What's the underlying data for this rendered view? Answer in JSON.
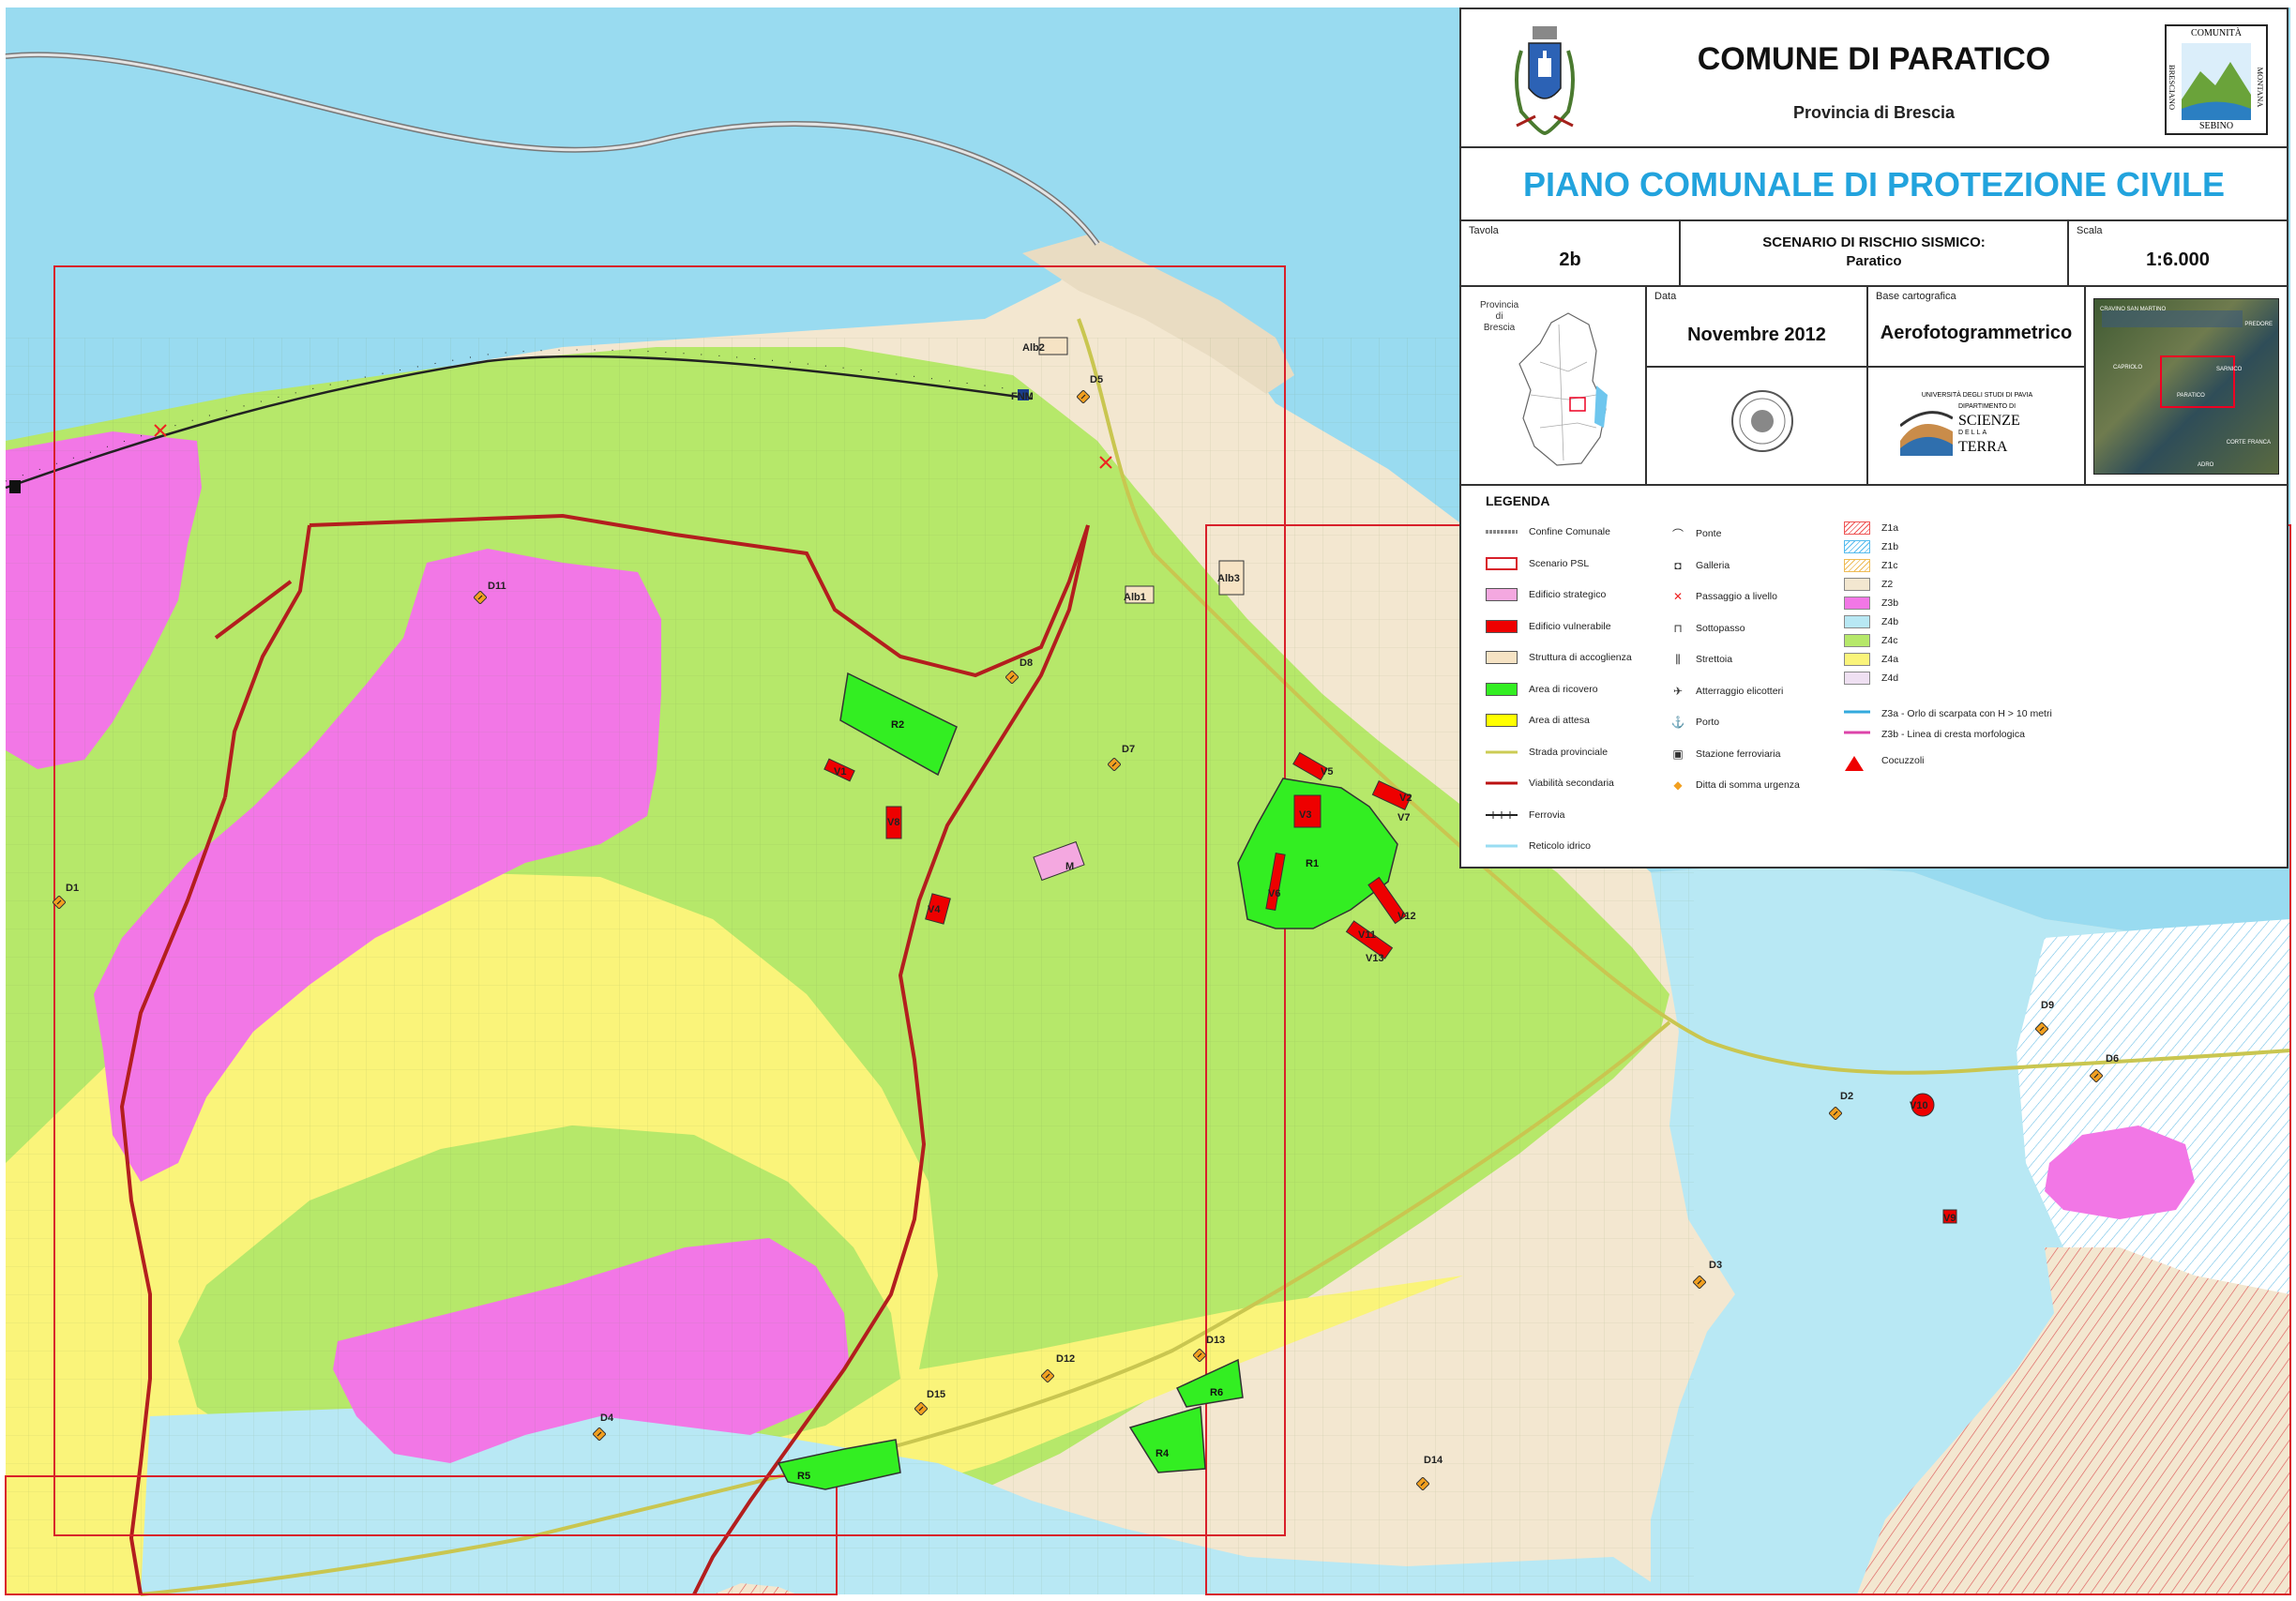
{
  "header": {
    "comune": "COMUNE DI PARATICO",
    "provincia": "Provincia di Brescia",
    "piano": "PIANO COMUNALE DI PROTEZIONE CIVILE",
    "tavola_label": "Tavola",
    "tavola_value": "2b",
    "scenario_line1": "SCENARIO DI RISCHIO SISMICO:",
    "scenario_line2": "Paratico",
    "scala_label": "Scala",
    "scala_value": "1:6.000",
    "data_label": "Data",
    "data_value": "Novembre 2012",
    "base_label": "Base cartografica",
    "base_value": "Aerofotogrammetrico",
    "inset_label_1": "Provincia",
    "inset_label_2": "di",
    "inset_label_3": "Brescia",
    "logo_right": {
      "top": "COMUNITÀ",
      "left": "BRESCIANO",
      "right": "MONTANA",
      "bottom": "SEBINO"
    },
    "unipv": {
      "line1": "UNIVERSITÀ DEGLI STUDI DI PAVIA",
      "line2": "DIPARTIMENTO DI",
      "line3": "SCIENZE",
      "line4": "DELLA",
      "line5": "TERRA"
    },
    "aerial_labels": [
      "CRAVINO SAN MARTINO",
      "PREDORE",
      "PARATICO",
      "SARNICO",
      "CORTE FRANCA",
      "ADRO",
      "CAPRIOLO"
    ]
  },
  "legend": {
    "title": "LEGENDA",
    "col1": [
      {
        "label": "Confine Comunale",
        "kind": "confine"
      },
      {
        "label": "Scenario PSL",
        "kind": "psl"
      },
      {
        "label": "Edificio strategico",
        "kind": "strategico",
        "color": "#f4a8e0"
      },
      {
        "label": "Edificio vulnerabile",
        "kind": "vulnerabile",
        "color": "#ee0000"
      },
      {
        "label": "Struttura di accoglienza",
        "kind": "accoglienza",
        "color": "#f6e3c4"
      },
      {
        "label": "Area di ricovero",
        "kind": "ricovero",
        "color": "#33ee22"
      },
      {
        "label": "Area di attesa",
        "kind": "attesa",
        "color": "#ffff00"
      },
      {
        "label": "Strada provinciale",
        "kind": "provinciale",
        "color": "#cccc55"
      },
      {
        "label": "Viabilità secondaria",
        "kind": "secondaria",
        "color": "#bb1111"
      },
      {
        "label": "Ferrovia",
        "kind": "ferrovia"
      },
      {
        "label": "Reticolo idrico",
        "kind": "idrico",
        "color": "#99ddf2"
      }
    ],
    "col2": [
      {
        "label": "Ponte",
        "icon": "ponte-icon",
        "glyph": "⌒"
      },
      {
        "label": "Galleria",
        "icon": "galleria-icon",
        "glyph": "◘"
      },
      {
        "label": "Passaggio a livello",
        "icon": "passaggio-livello-icon",
        "glyph": "✕"
      },
      {
        "label": "Sottopasso",
        "icon": "sottopasso-icon",
        "glyph": "⊓"
      },
      {
        "label": "Strettoia",
        "icon": "strettoia-icon",
        "glyph": "⫼"
      },
      {
        "label": "Atterraggio elicotteri",
        "icon": "elicotteri-icon",
        "glyph": "✈"
      },
      {
        "label": "Porto",
        "icon": "porto-icon",
        "glyph": "⚓"
      },
      {
        "label": "Stazione ferroviaria",
        "icon": "stazione-icon",
        "glyph": "▣"
      },
      {
        "label": "Ditta di somma urgenza",
        "icon": "ditta-icon",
        "glyph": "◆"
      }
    ],
    "col3": [
      {
        "label": "Z1a",
        "kind": "hatch",
        "color": "#ee5555"
      },
      {
        "label": "Z1b",
        "kind": "hatch",
        "color": "#55bbee"
      },
      {
        "label": "Z1c",
        "kind": "hatch",
        "color": "#eebb55"
      },
      {
        "label": "Z2",
        "kind": "solid",
        "color": "#f3e7d0"
      },
      {
        "label": "Z3b",
        "kind": "solid",
        "color": "#f277e6"
      },
      {
        "label": "Z4b",
        "kind": "solid",
        "color": "#b8e8f4"
      },
      {
        "label": "Z4c",
        "kind": "solid",
        "color": "#b6e86a"
      },
      {
        "label": "Z4a",
        "kind": "solid",
        "color": "#faf47a"
      },
      {
        "label": "Z4d",
        "kind": "solid",
        "color": "#efe0f2"
      }
    ],
    "lines": [
      {
        "label": "Z3a - Orlo di scarpata con H > 10 metri",
        "color": "#33aadd"
      },
      {
        "label": "Z3b - Linea di cresta morfologica",
        "color": "#dd44aa"
      }
    ],
    "cocuzzoli": "Cocuzzoli"
  },
  "map_labels": {
    "areas": [
      "R1",
      "R2",
      "R4",
      "R5",
      "R6"
    ],
    "ditte": [
      "D1",
      "D2",
      "D3",
      "D4",
      "D5",
      "D6",
      "D7",
      "D8",
      "D9",
      "D11",
      "D12",
      "D13",
      "D14",
      "D15"
    ],
    "vulnerabili": [
      "V1",
      "V2",
      "V3",
      "V4",
      "V5",
      "V6",
      "V7",
      "V8",
      "V9",
      "V10",
      "V11",
      "V12",
      "V13"
    ],
    "accoglienza": [
      "Alb1",
      "Alb2",
      "Alb3"
    ],
    "strategico": "M",
    "station": "FNM"
  },
  "colors": {
    "lake": "#99dbf0",
    "z2": "#f3e7d0",
    "z4c": "#b6e86a",
    "z4a": "#faf47a",
    "z3b": "#f277e6",
    "z4b": "#b8e8f4",
    "title_blue": "#22a3dd"
  }
}
